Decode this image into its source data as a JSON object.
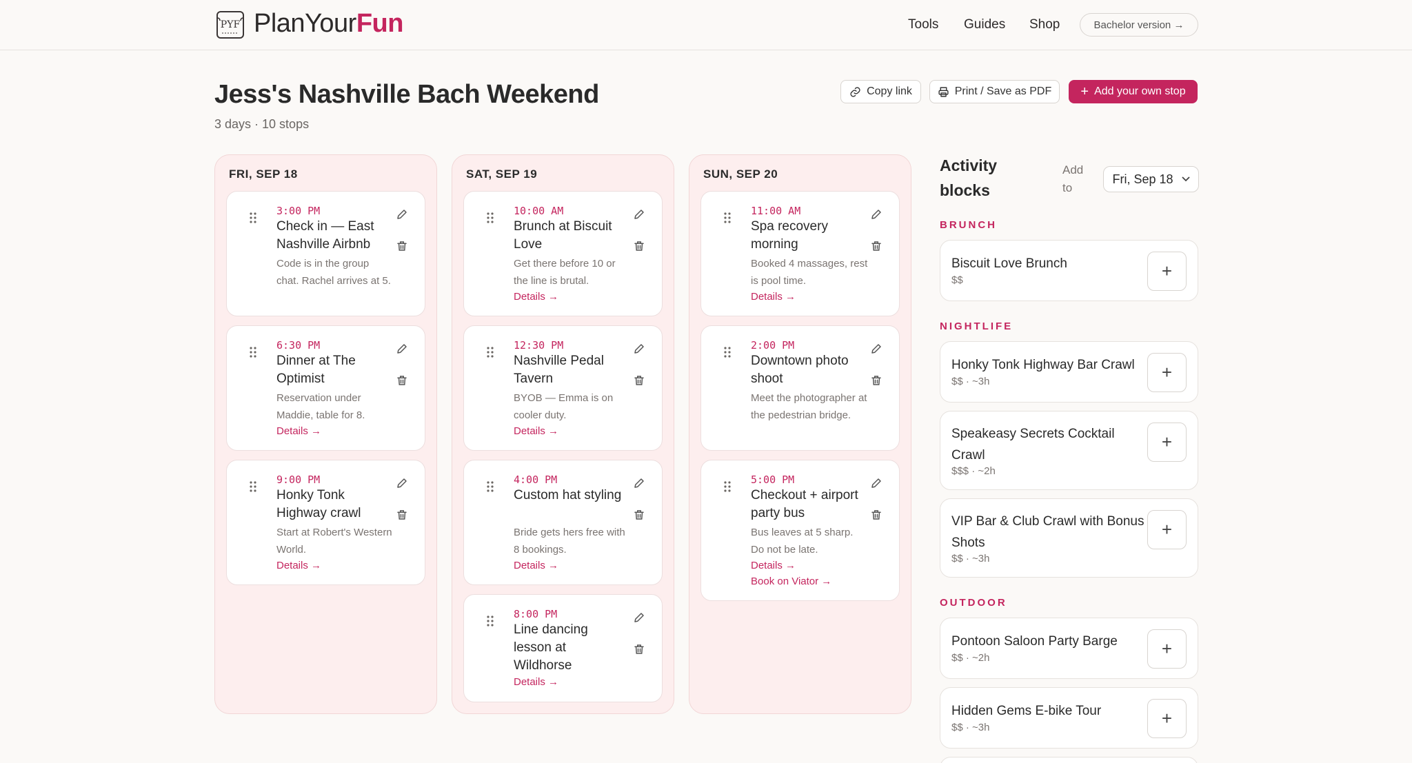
{
  "brand": {
    "name_a": "PlanYour",
    "name_b": "Fun",
    "mark": "PYF",
    "accent": "#c4255e"
  },
  "nav": {
    "tools": "Tools",
    "guides": "Guides",
    "shop": "Shop",
    "bachelor": "Bachelor version →"
  },
  "page": {
    "title": "Jess's Nashville Bach Weekend",
    "subtitle": "3 days · 10 stops"
  },
  "actions": {
    "copy": "Copy link",
    "print": "Print / Save as PDF",
    "add": "Add your own stop"
  },
  "days": [
    {
      "label": "FRI, SEP 18",
      "stops": [
        {
          "time": "3:00 PM",
          "title": "Check in — East Nashville Airbnb",
          "note": "Code is in the group chat. Rachel arrives at 5.",
          "details": ""
        },
        {
          "time": "6:30 PM",
          "title": "Dinner at The Optimist",
          "note": "Reservation under Maddie, table for 8.",
          "details": "Details →"
        },
        {
          "time": "9:00 PM",
          "title": "Honky Tonk Highway crawl",
          "note": "Start at Robert's Western World.",
          "details": "Details →"
        }
      ]
    },
    {
      "label": "SAT, SEP 19",
      "stops": [
        {
          "time": "10:00 AM",
          "title": "Brunch at Biscuit Love",
          "note": "Get there before 10 or the line is brutal.",
          "details": "Details →"
        },
        {
          "time": "12:30 PM",
          "title": "Nashville Pedal Tavern",
          "note": "BYOB — Emma is on cooler duty.",
          "details": "Details →"
        },
        {
          "time": "4:00 PM",
          "title": "Custom hat styling",
          "note": "Bride gets hers free with 8 bookings.",
          "details": "Details →"
        },
        {
          "time": "8:00 PM",
          "title": "Line dancing lesson at Wildhorse",
          "note": "",
          "details": "Details →"
        }
      ]
    },
    {
      "label": "SUN, SEP 20",
      "stops": [
        {
          "time": "11:00 AM",
          "title": "Spa recovery morning",
          "note": "Booked 4 massages, rest is pool time.",
          "details": "Details →"
        },
        {
          "time": "2:00 PM",
          "title": "Downtown photo shoot",
          "note": "Meet the photographer at the pedestrian bridge.",
          "details": ""
        },
        {
          "time": "5:00 PM",
          "title": "Checkout + airport party bus",
          "note": "Bus leaves at 5 sharp. Do not be late.",
          "details": "Details →",
          "extra": "Book on Viator →"
        }
      ]
    }
  ],
  "sidebar": {
    "title": "Activity blocks",
    "add_to": "Add to",
    "selected_day": "Fri, Sep 18",
    "categories": [
      {
        "label": "BRUNCH",
        "items": [
          {
            "name": "Biscuit Love Brunch",
            "meta": "$$"
          }
        ]
      },
      {
        "label": "NIGHTLIFE",
        "items": [
          {
            "name": "Honky Tonk Highway Bar Crawl",
            "meta": "$$ · ~3h"
          },
          {
            "name": "Speakeasy Secrets Cocktail Crawl",
            "meta": "$$$ · ~2h"
          },
          {
            "name": "VIP Bar & Club Crawl with Bonus Shots",
            "meta": "$$ · ~3h"
          }
        ]
      },
      {
        "label": "OUTDOOR",
        "items": [
          {
            "name": "Pontoon Saloon Party Barge",
            "meta": "$$ · ~2h"
          },
          {
            "name": "Hidden Gems E-bike Tour",
            "meta": "$$ · ~3h"
          }
        ]
      }
    ]
  }
}
